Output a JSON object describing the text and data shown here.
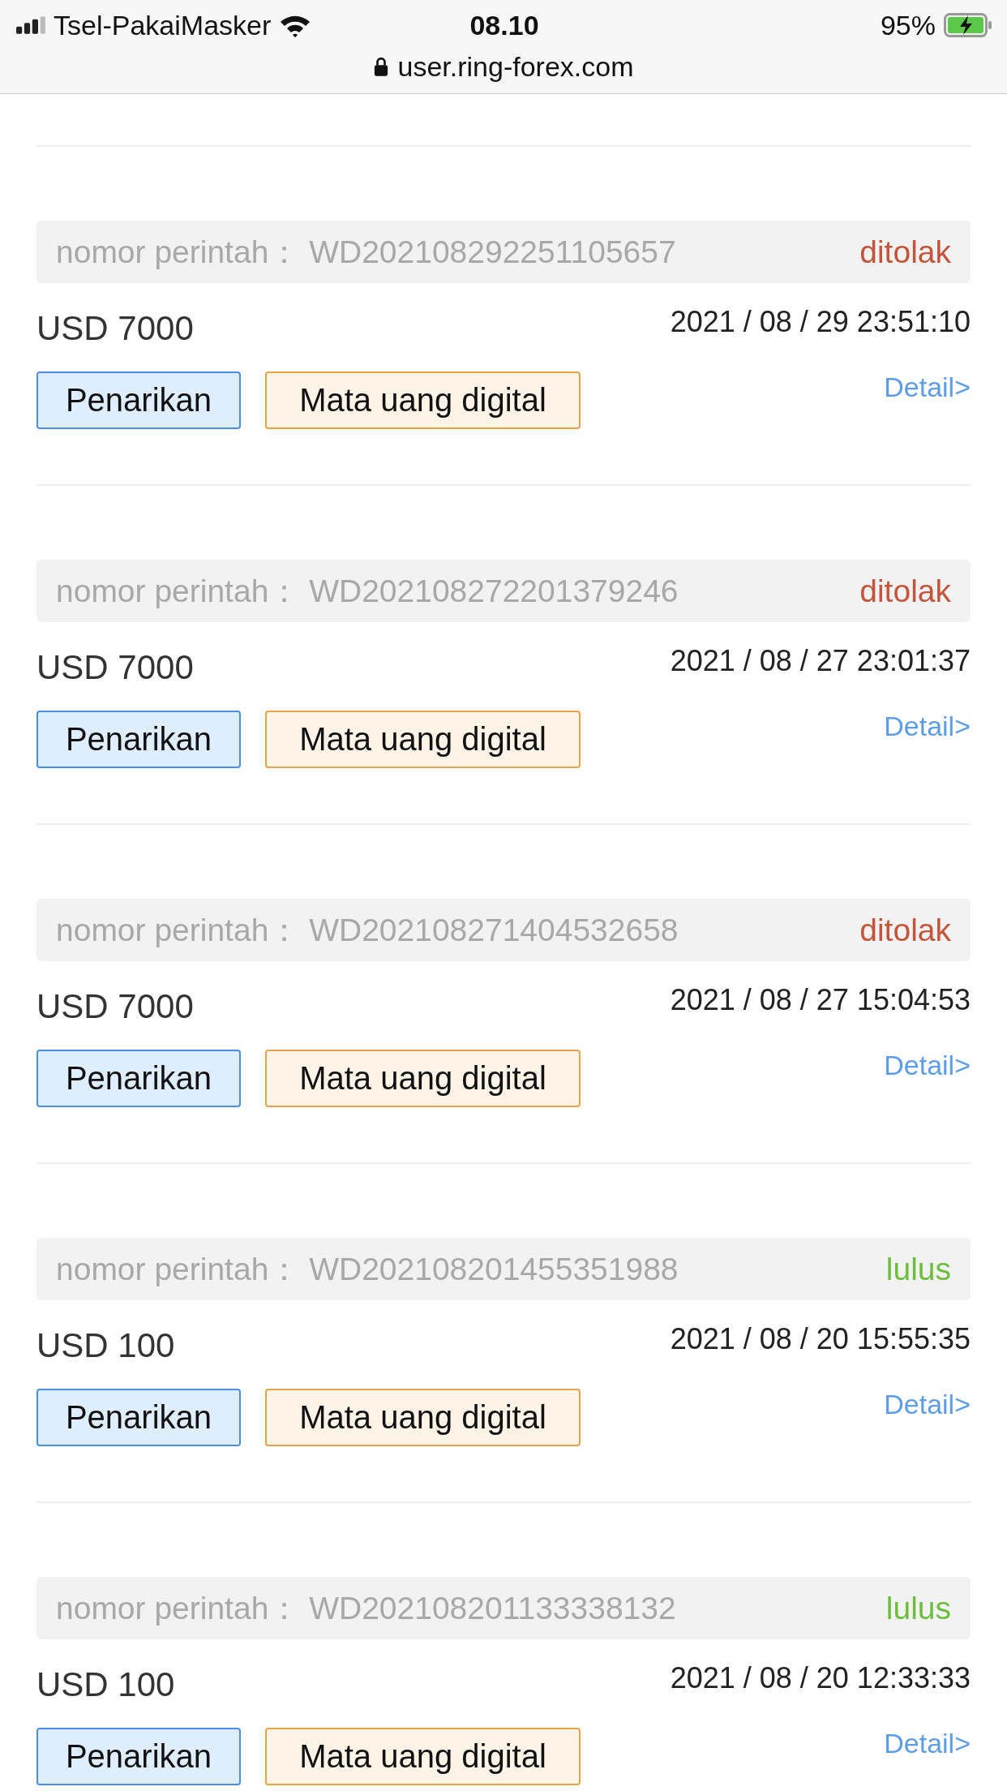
{
  "status_bar": {
    "carrier": "Tsel-PakaiMasker",
    "time": "08.10",
    "battery": "95%",
    "url": "user.ring-forex.com"
  },
  "orders": [
    {
      "label": "nomor perintah：",
      "order_no": "WD202108292251105657",
      "status": {
        "text": "ditolak",
        "color": "#c4553a"
      },
      "amount": "USD 7000",
      "datetime": "2021 / 08 / 29 23:51:10",
      "tags": [
        "Penarikan",
        "Mata uang digital"
      ],
      "link": "Detail>"
    },
    {
      "label": "nomor perintah：",
      "order_no": "WD202108272201379246",
      "status": {
        "text": "ditolak",
        "color": "#c4553a"
      },
      "amount": "USD 7000",
      "datetime": "2021 / 08 / 27 23:01:37",
      "tags": [
        "Penarikan",
        "Mata uang digital"
      ],
      "link": "Detail>"
    },
    {
      "label": "nomor perintah：",
      "order_no": "WD202108271404532658",
      "status": {
        "text": "ditolak",
        "color": "#c4553a"
      },
      "amount": "USD 7000",
      "datetime": "2021 / 08 / 27 15:04:53",
      "tags": [
        "Penarikan",
        "Mata uang digital"
      ],
      "link": "Detail>"
    },
    {
      "label": "nomor perintah：",
      "order_no": "WD202108201455351988",
      "status": {
        "text": "lulus",
        "color": "#6cbf3a"
      },
      "amount": "USD 100",
      "datetime": "2021 / 08 / 20 15:55:35",
      "tags": [
        "Penarikan",
        "Mata uang digital"
      ],
      "link": "Detail>"
    },
    {
      "label": "nomor perintah：",
      "order_no": "WD202108201133338132",
      "status": {
        "text": "lulus",
        "color": "#6cbf3a"
      },
      "amount": "USD 100",
      "datetime": "2021 / 08 / 20 12:33:33",
      "tags": [
        "Penarikan",
        "Mata uang digital"
      ],
      "link": "Detail>"
    }
  ]
}
